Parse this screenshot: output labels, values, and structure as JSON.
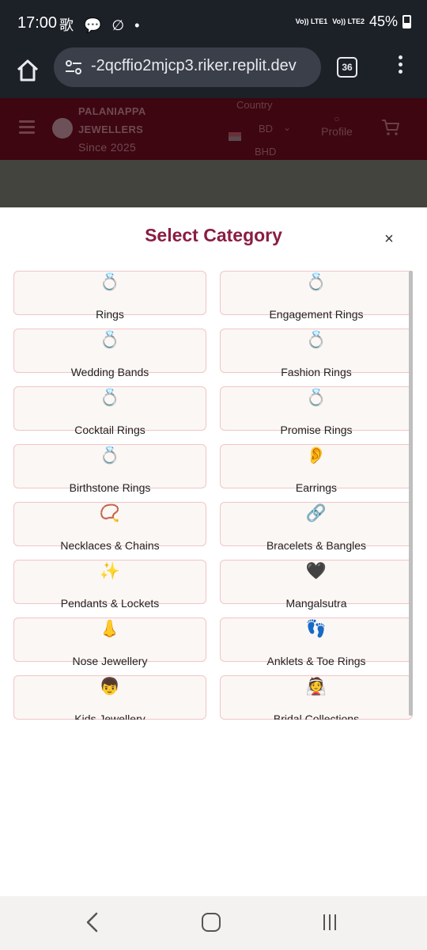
{
  "status_bar": {
    "time": "17:00",
    "left_icons": "歌 💬 ∅ •",
    "sim1": "Vo)) LTE1",
    "sim2": "Vo)) LTE2",
    "battery": "45%"
  },
  "browser": {
    "url": "-2qcffio2mjcp3.riker.replit.dev",
    "tab_count": "36"
  },
  "site_header": {
    "brand_line1": "PALANIAPPA",
    "brand_line2": "JEWELLERS",
    "brand_since": "Since 2025",
    "country_label": "Country",
    "country_code": "BD",
    "currency": "BHD",
    "profile_label": "Profile"
  },
  "modal": {
    "title": "Select Category",
    "close_glyph": "×",
    "categories": [
      {
        "icon": "💍",
        "label": "Rings"
      },
      {
        "icon": "💍",
        "label": "Engagement Rings"
      },
      {
        "icon": "💍",
        "label": "Wedding Bands"
      },
      {
        "icon": "💍",
        "label": "Fashion Rings"
      },
      {
        "icon": "💍",
        "label": "Cocktail Rings"
      },
      {
        "icon": "💍",
        "label": "Promise Rings"
      },
      {
        "icon": "💍",
        "label": "Birthstone Rings"
      },
      {
        "icon": "👂",
        "label": "Earrings"
      },
      {
        "icon": "📿",
        "label": "Necklaces & Chains"
      },
      {
        "icon": "🔗",
        "label": "Bracelets & Bangles"
      },
      {
        "icon": "✨",
        "label": "Pendants & Lockets"
      },
      {
        "icon": "🖤",
        "label": "Mangalsutra"
      },
      {
        "icon": "👃",
        "label": "Nose Jewellery"
      },
      {
        "icon": "👣",
        "label": "Anklets & Toe Rings"
      },
      {
        "icon": "👦",
        "label": "Kids Jewellery"
      },
      {
        "icon": "👰",
        "label": "Bridal Collections"
      }
    ]
  }
}
